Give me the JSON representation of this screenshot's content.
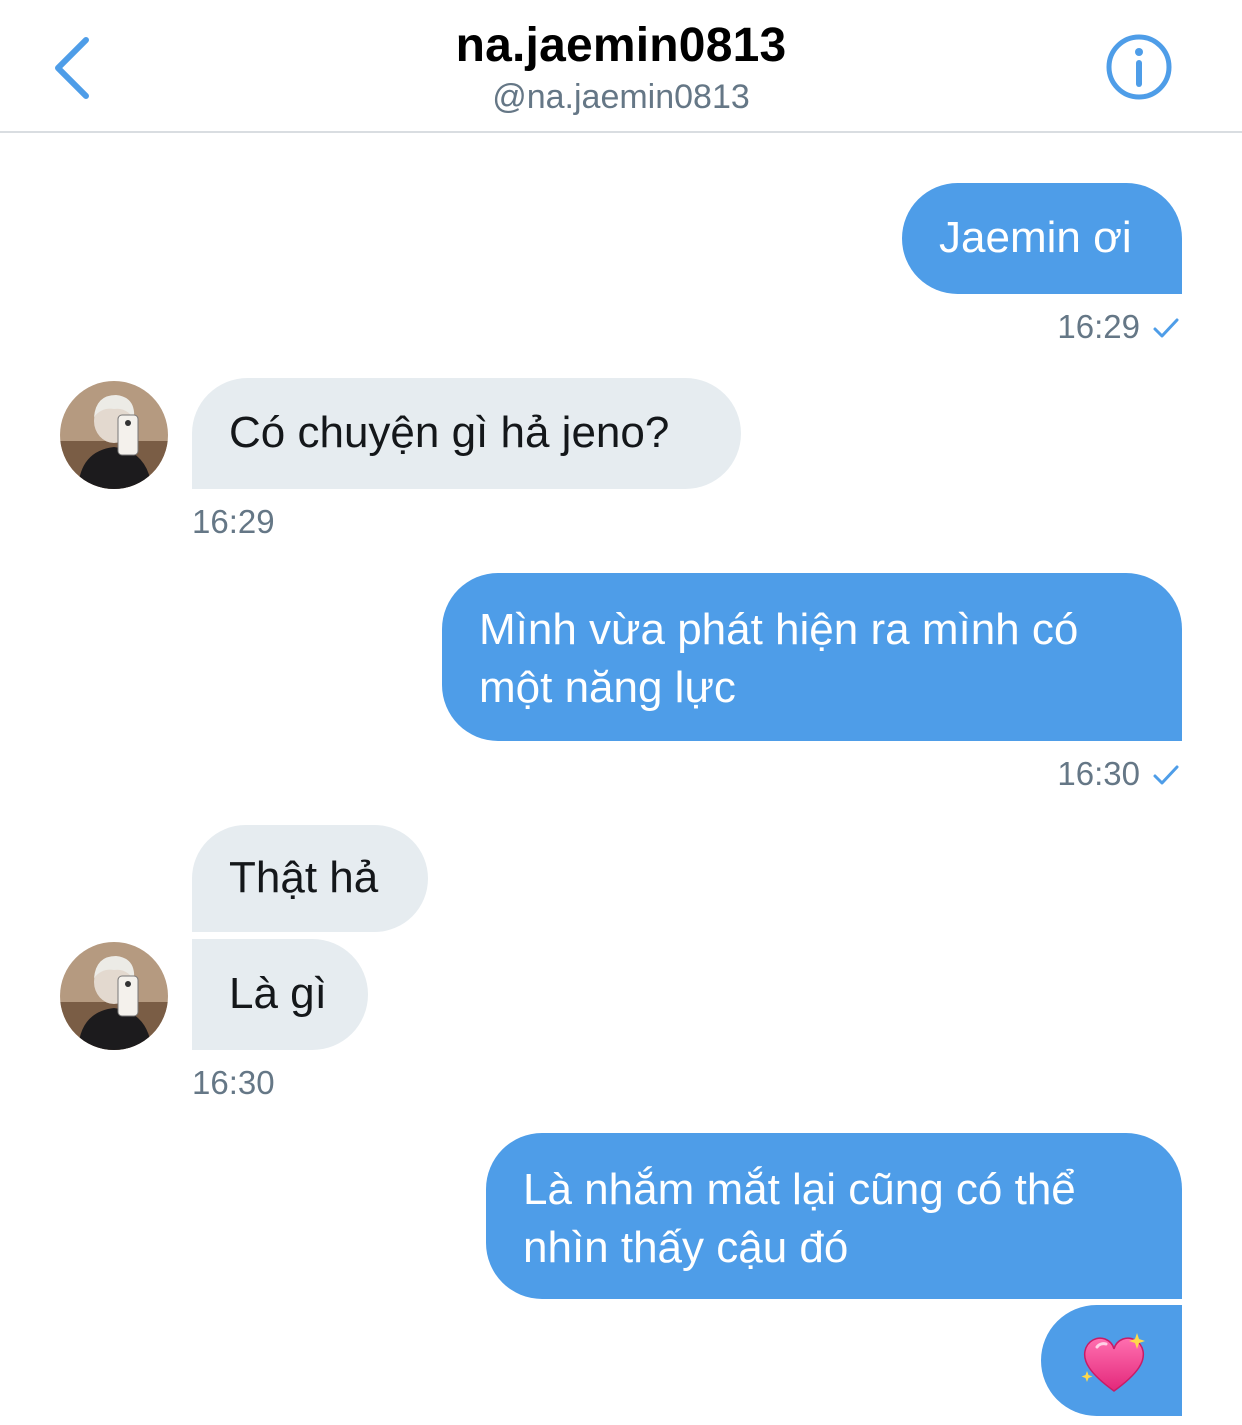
{
  "header": {
    "title": "na.jaemin0813",
    "handle": "@na.jaemin0813"
  },
  "colors": {
    "accent": "#4e9de8",
    "incoming_bubble": "#e6ecf0",
    "secondary_text": "#657786"
  },
  "messages": [
    {
      "direction": "outgoing",
      "text": "Jaemin ơi"
    },
    {
      "direction": "outgoing",
      "time": "16:29",
      "status": "check-icon"
    },
    {
      "direction": "incoming",
      "text": "Có chuyện gì hả jeno?",
      "time": "16:29"
    },
    {
      "direction": "outgoing",
      "text_line1": "Mình vừa phát hiện ra mình có",
      "text_line2": "một năng lực",
      "time": "16:30"
    },
    {
      "direction": "incoming",
      "text": "Thật hả"
    },
    {
      "direction": "incoming",
      "text": "Là gì",
      "time": "16:30"
    },
    {
      "direction": "outgoing",
      "text_line1": "Là nhắm mắt lại cũng có thể",
      "text_line2": "nhìn thấy cậu đó"
    },
    {
      "direction": "outgoing",
      "emoji": "sparkling-heart-icon"
    }
  ]
}
